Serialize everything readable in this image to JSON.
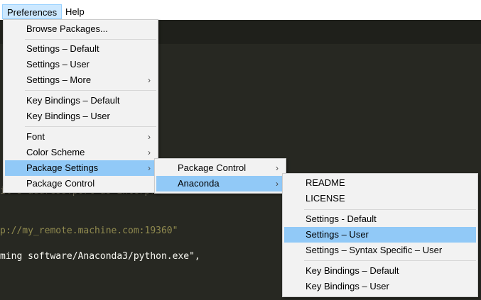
{
  "menubar": {
    "preferences": "Preferences",
    "help": "Help"
  },
  "editor": {
    "lines": [
      "il's address:port as interpreter",
      "p://my_remote.machine.com:19360\"",
      "ming software/Anaconda3/python.exe\","
    ]
  },
  "preferences_menu": {
    "items": [
      {
        "label": "Browse Packages..."
      },
      {
        "label": "Settings – Default"
      },
      {
        "label": "Settings – User"
      },
      {
        "label": "Settings – More"
      },
      {
        "label": "Key Bindings – Default"
      },
      {
        "label": "Key Bindings – User"
      },
      {
        "label": "Font"
      },
      {
        "label": "Color Scheme"
      },
      {
        "label": "Package Settings"
      },
      {
        "label": "Package Control"
      }
    ]
  },
  "package_settings_menu": {
    "items": [
      {
        "label": "Package Control"
      },
      {
        "label": "Anaconda"
      }
    ]
  },
  "anaconda_menu": {
    "items": [
      {
        "label": "README"
      },
      {
        "label": "LICENSE"
      },
      {
        "label": "Settings - Default"
      },
      {
        "label": "Settings – User"
      },
      {
        "label": "Settings – Syntax Specific – User"
      },
      {
        "label": "Key Bindings – Default"
      },
      {
        "label": "Key Bindings – User"
      }
    ]
  },
  "colors": {
    "editor_bg": "#272822",
    "menu_bg": "#f2f2f2",
    "highlight": "#91c9f7"
  }
}
